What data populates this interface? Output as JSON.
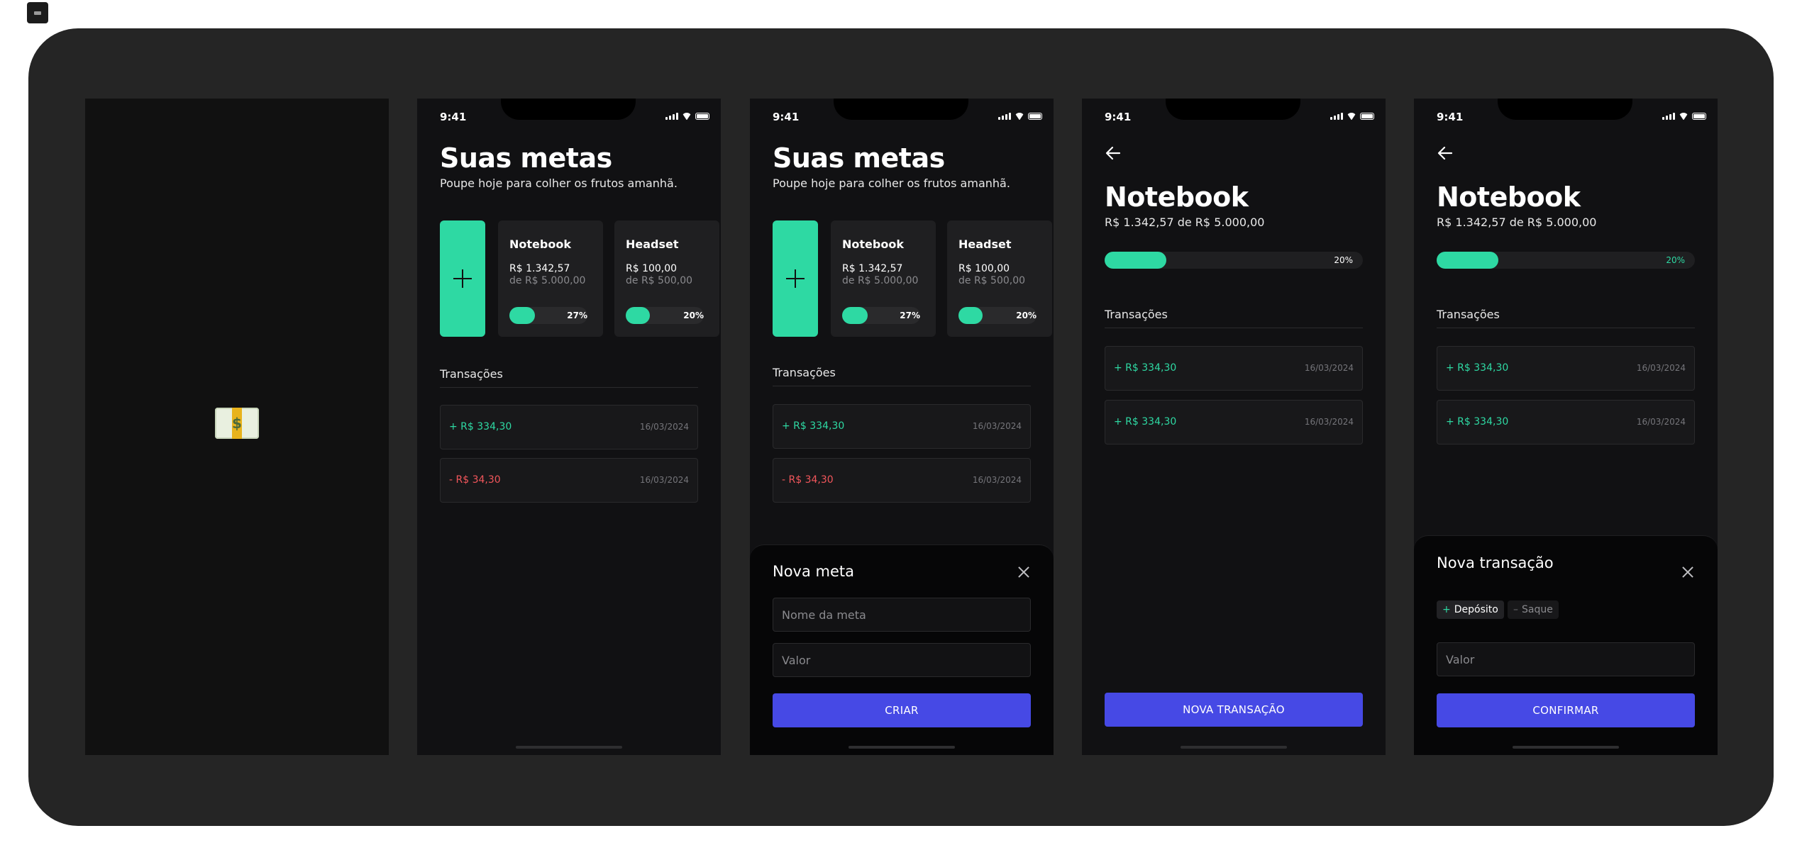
{
  "colors": {
    "accent_green": "#2ed9a3",
    "negative_red": "#f2565b",
    "primary_button": "#4649e5",
    "screen_background": "#111113",
    "frame_background": "#252525"
  },
  "status_bar": {
    "time": "9:41"
  },
  "goals_screen": {
    "title": "Suas metas",
    "subtitle": "Poupe hoje para colher os frutos amanhã.",
    "goals": [
      {
        "name": "Notebook",
        "value": "R$ 1.342,57",
        "of": "de R$ 5.000,00",
        "percent_label": "27%",
        "progress": 0.27
      },
      {
        "name": "Headset",
        "value": "R$ 100,00",
        "of": "de R$ 500,00",
        "percent_label": "20%",
        "progress": 0.2
      }
    ],
    "transactions_title": "Transações",
    "transactions": [
      {
        "amount": "+ R$ 334,30",
        "date": "16/03/2024",
        "type": "deposit"
      },
      {
        "amount": "- R$ 34,30",
        "date": "16/03/2024",
        "type": "withdrawal"
      }
    ]
  },
  "new_goal_sheet": {
    "title": "Nova meta",
    "name_placeholder": "Nome da meta",
    "value_placeholder": "Valor",
    "submit_label": "CRIAR"
  },
  "goal_detail": {
    "title": "Notebook",
    "summary": "R$ 1.342,57 de R$ 5.000,00",
    "percent_label": "20%",
    "progress": 0.2,
    "transactions_title": "Transações",
    "transactions": [
      {
        "amount": "+ R$ 334,30",
        "date": "16/03/2024"
      },
      {
        "amount": "+ R$ 334,30",
        "date": "16/03/2024"
      }
    ],
    "new_transaction_label": "NOVA TRANSAÇÃO"
  },
  "new_transaction_sheet": {
    "title": "Nova transação",
    "deposit_label": "Depósito",
    "withdraw_label": "Saque",
    "value_placeholder": "Valor",
    "submit_label": "CONFIRMAR"
  },
  "icons": {
    "corner": "app-icon",
    "splash": "money-with-wings-icon",
    "add": "plus-icon",
    "back": "arrow-left-icon",
    "close": "close-icon",
    "deposit": "plus-small-icon",
    "withdraw": "minus-small-icon"
  }
}
